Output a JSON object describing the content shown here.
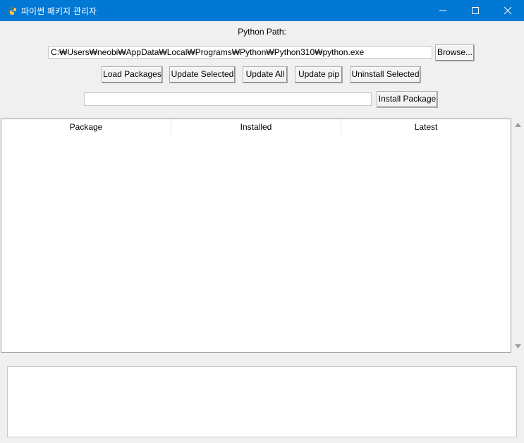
{
  "window": {
    "title": "파이썬 패키지 관리자",
    "app_icon": "python-icon",
    "titlebar_color": "#0078d4"
  },
  "path": {
    "label": "Python Path:",
    "value": "C:₩Users₩neobi₩AppData₩Local₩Programs₩Python₩Python310₩python.exe",
    "browse_label": "Browse..."
  },
  "toolbar": {
    "load_label": "Load Packages",
    "update_selected_label": "Update Selected",
    "update_all_label": "Update All",
    "update_pip_label": "Update pip",
    "uninstall_selected_label": "Uninstall Selected"
  },
  "install": {
    "value": "",
    "button_label": "Install Package"
  },
  "table": {
    "columns": [
      "Package",
      "Installed",
      "Latest"
    ],
    "rows": []
  },
  "log": {
    "text": ""
  }
}
